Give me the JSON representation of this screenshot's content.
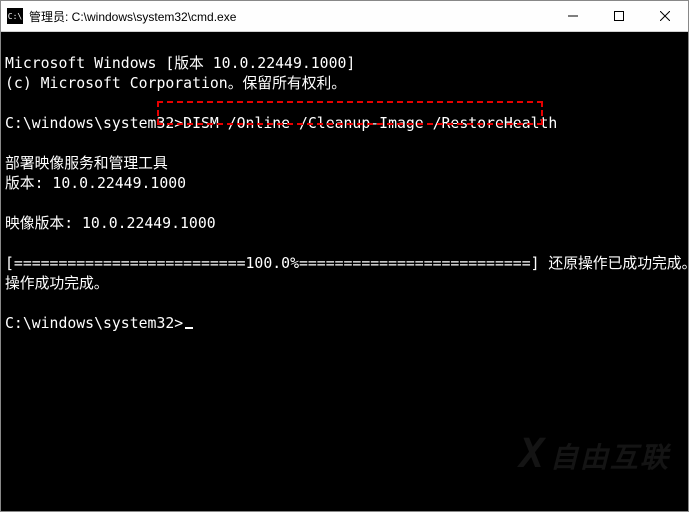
{
  "titlebar": {
    "icon_label": "C:\\",
    "title": "管理员: C:\\windows\\system32\\cmd.exe"
  },
  "terminal": {
    "line1": "Microsoft Windows [版本 10.0.22449.1000]",
    "line2": "(c) Microsoft Corporation。保留所有权利。",
    "prompt1_path": "C:\\windows\\system32>",
    "prompt1_cmd": "DISM /Online /Cleanup-Image /RestoreHealth",
    "tool_title": "部署映像服务和管理工具",
    "tool_version": "版本: 10.0.22449.1000",
    "image_version": "映像版本: 10.0.22449.1000",
    "progress_line": "[==========================100.0%==========================] 还原操作已成功完成。",
    "success_line": "操作成功完成。",
    "prompt2_path": "C:\\windows\\system32>"
  },
  "watermark": {
    "text": "自由互联"
  }
}
